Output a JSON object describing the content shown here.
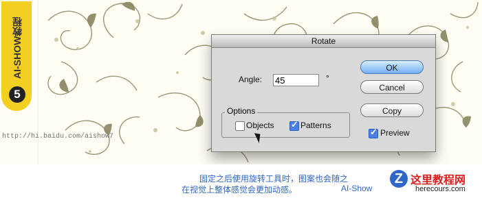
{
  "dialog": {
    "title": "Rotate",
    "angle_label": "Angle:",
    "angle_value": "45",
    "degree_symbol": "°",
    "options_label": "Options",
    "objects_label": "Objects",
    "objects_checked": false,
    "patterns_label": "Patterns",
    "patterns_checked": true,
    "ok_label": "OK",
    "cancel_label": "Cancel",
    "copy_label": "Copy",
    "preview_label": "Preview",
    "preview_checked": true
  },
  "sidebar": {
    "brand": "AI-SHOW教程",
    "step_number": "5",
    "source_text": "http://hi.baidu.com/aishow7"
  },
  "caption": {
    "line1": "固定之后使用旋转工具时，图案也会随之",
    "line2": "在视觉上整体感觉会更加动感。",
    "credit": "AI-Show"
  },
  "site": {
    "title": "这里教程网",
    "domain": "herecours.com",
    "logo_letter": "Z"
  },
  "colors": {
    "pattern_background": "#fffdf4",
    "pattern_primary": "#8f8b66",
    "pattern_light": "#c9c29d",
    "brand_yellow": "#f2cf21",
    "caption_blue": "#2f66c9",
    "dialog_gray": "#d9d9d9",
    "ok_blue": "#73aef2"
  },
  "icons": {
    "cursor": "cursor-arrow-icon",
    "checkbox": "checkbox-icon",
    "ornament": "floral-scroll-icon"
  }
}
